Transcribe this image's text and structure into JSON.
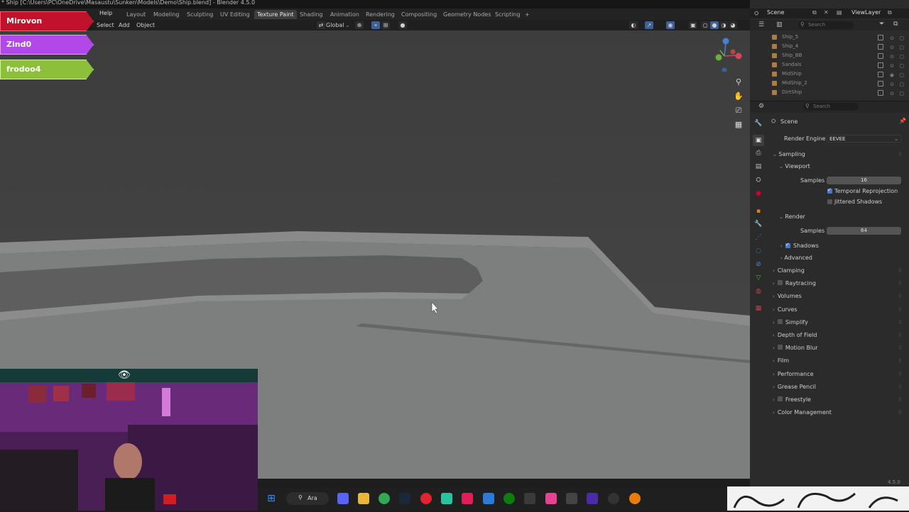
{
  "window": {
    "title": "* Ship [C:\\Users\\PC\\OneDrive\\Masaustu\\Sunken\\Models\\Demo\\Ship.blend] - Blender 4.5.0",
    "help_menu": "Help",
    "workspace_tabs": [
      "Layout",
      "Modeling",
      "Sculpting",
      "UV Editing",
      "Texture Paint",
      "Shading",
      "Animation",
      "Rendering",
      "Compositing",
      "Geometry Nodes",
      "Scripting"
    ],
    "active_workspace": "Texture Paint",
    "add_workspace": "+"
  },
  "viewport_header": {
    "menus": [
      "Select",
      "Add",
      "Object"
    ],
    "transform_orientation": "Global"
  },
  "overlay_badges": [
    {
      "label": "Mirovon",
      "color": "#c0132b"
    },
    {
      "label": "Zind0",
      "color": "#b248e8"
    },
    {
      "label": "frodoo4",
      "color": "#8cbf3a"
    }
  ],
  "top_right": {
    "scene_label": "Scene",
    "view_layer_label": "ViewLayer",
    "search_placeholder": "Search"
  },
  "outliner": {
    "items": [
      "Ship_5",
      "Ship_4",
      "Ship_BB",
      "Sandals",
      "MidShip",
      "MidShip_2",
      "DirtShip"
    ]
  },
  "properties": {
    "search_placeholder": "Search",
    "context": "Scene",
    "render_engine_label": "Render Engine",
    "render_engine_value": "EEVEE",
    "sampling": "Sampling",
    "viewport": "Viewport",
    "viewport_samples_label": "Samples",
    "viewport_samples": "16",
    "temporal_reprojection": "Temporal Reprojection",
    "jittered_shadows": "Jittered Shadows",
    "render": "Render",
    "render_samples_label": "Samples",
    "render_samples": "64",
    "shadows": "Shadows",
    "advanced": "Advanced",
    "panels": [
      "Clamping",
      "Raytracing",
      "Volumes",
      "Curves",
      "Simplify",
      "Depth of Field",
      "Motion Blur",
      "Film",
      "Performance",
      "Grease Pencil",
      "Freestyle",
      "Color Management"
    ]
  },
  "taskbar": {
    "search_label": "Ara"
  },
  "status": {
    "version": "4.5.0"
  }
}
